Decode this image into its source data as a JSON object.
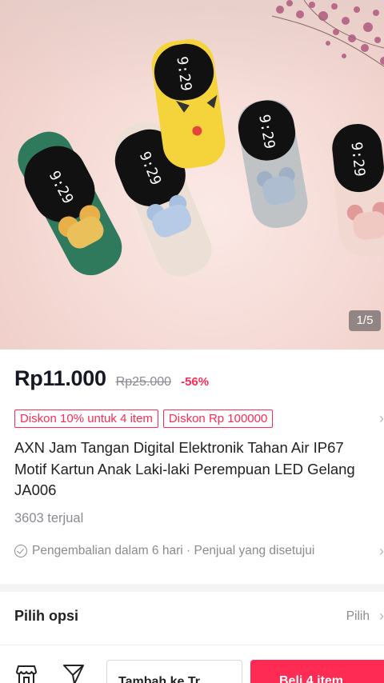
{
  "gallery": {
    "counter": "1/5",
    "image_subject": "Jam tangan digital anak dengan motif kartun",
    "watch_display": "9:29"
  },
  "product": {
    "price": "Rp11.000",
    "original_price": "Rp25.000",
    "discount_percent": "-56%",
    "promos": [
      "Diskon 10% untuk 4 item",
      "Diskon Rp 100000"
    ],
    "title": "AXN Jam Tangan Digital Elektronik Tahan Air IP67 Motif Kartun Anak Laki-laki Perempuan LED Gelang JA006",
    "sold": "3603 terjual",
    "returns_policy": "Pengembalian dalam 6 hari · Penjual yang disetujui"
  },
  "options": {
    "label": "Pilih opsi",
    "value": "Pilih"
  },
  "bottom_bar": {
    "add_to_cart_label": "Tambah ke Tr",
    "buy_now_label": "Beli 4 item"
  },
  "colors": {
    "accent": "#fe2c55",
    "muted_text": "#8a8b91",
    "primary_text": "#161823"
  },
  "icons": {
    "store": "store-icon",
    "chat": "chat-icon",
    "chevron": "chevron-right-icon",
    "check": "check-circle-icon"
  }
}
